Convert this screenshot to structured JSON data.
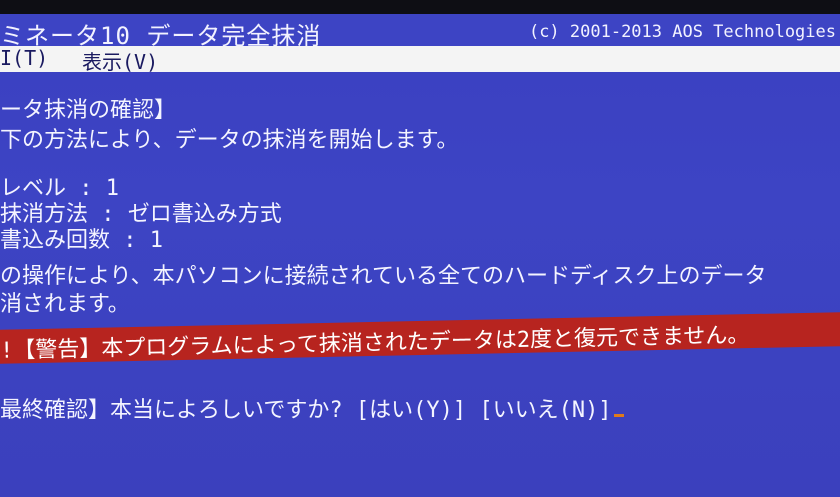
{
  "window": {
    "title": "ミネータ10 データ完全抹消",
    "copyright": "(c) 2001-2013 AOS Technologies"
  },
  "menu": {
    "items": [
      "I(T)",
      "表示(V)"
    ]
  },
  "content": {
    "heading": "ータ抹消の確認】",
    "intro": "下の方法により、データの抹消を開始します。",
    "level": "レベル       : 1",
    "method": "抹消方法     : ゼロ書込み方式",
    "count": "書込み回数   : 1",
    "notice_line1": "の操作により、本パソコンに接続されている全てのハードディスク上のデータ",
    "notice_line2": "消されます。",
    "warning": "!【警告】本プログラムによって抹消されたデータは2度と復元できません。",
    "confirm_label": "最終確認】本当によろしいですか? ",
    "yes_label": "[はい(Y)]",
    "no_label": "[いいえ(N)]"
  },
  "colors": {
    "screen_bg": "#3d44c4",
    "warning_bg": "#b7241f",
    "menu_bg": "#f4f4f4",
    "cursor": "#e07a1a"
  }
}
